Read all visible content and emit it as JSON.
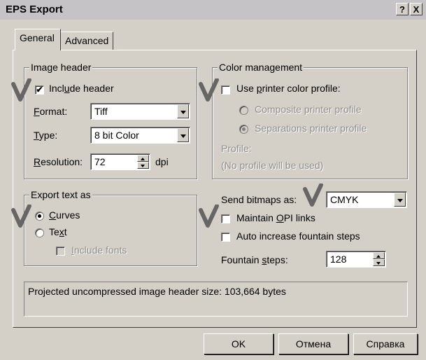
{
  "window": {
    "title": "EPS Export",
    "help_label": "?",
    "close_label": "X"
  },
  "tabs": [
    {
      "label": "General"
    },
    {
      "label": "Advanced"
    }
  ],
  "image_header": {
    "legend": "Image header",
    "include_header": {
      "pre": "Incl",
      "u": "u",
      "post": "de header",
      "checked": "✔"
    },
    "format": {
      "pre": "",
      "u": "F",
      "post": "ormat:",
      "value": "Tiff"
    },
    "type": {
      "pre": "",
      "u": "T",
      "post": "ype:",
      "value": "8 bit Color"
    },
    "resolution": {
      "pre": "",
      "u": "R",
      "post": "esolution:",
      "value": "72",
      "unit": "dpi"
    }
  },
  "color_management": {
    "legend": "Color management",
    "use_profile": {
      "pre": "Use ",
      "u": "p",
      "post": "rinter color profile:"
    },
    "composite": "Composite printer profile",
    "separations": "Separations printer profile",
    "profile_label": "Profile:",
    "profile_value": "(No profile will be used)"
  },
  "export_text": {
    "legend": "Export text as",
    "curves": {
      "pre": "",
      "u": "C",
      "post": "urves"
    },
    "text": {
      "pre": "Te",
      "u": "x",
      "post": "t"
    },
    "include_fonts": {
      "pre": "",
      "u": "I",
      "post": "nclude fonts"
    }
  },
  "bitmaps": {
    "send_label": "Send bitmaps as:",
    "send_value": "CMYK",
    "opi": {
      "pre": "Maintain ",
      "u": "O",
      "post": "PI links"
    },
    "auto_fountain": "Auto increase fountain steps",
    "fountain": {
      "pre": "Fountain ",
      "u": "s",
      "post": "teps:",
      "value": "128"
    }
  },
  "info": {
    "text": "Projected uncompressed image header size: 103,664 bytes"
  },
  "buttons": {
    "ok": "OK",
    "cancel": "Отмена",
    "help": "Справка"
  },
  "colors": {
    "face": "#d4d0c8",
    "annotation_mark": "#666666"
  }
}
